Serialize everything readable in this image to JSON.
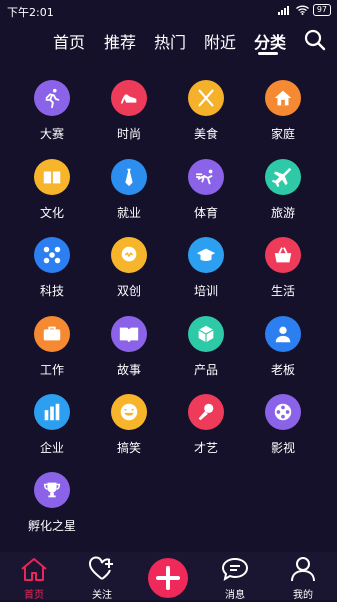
{
  "status": {
    "time": "下午2:01",
    "battery": "97"
  },
  "nav": {
    "tabs": [
      "首页",
      "推荐",
      "热门",
      "附近",
      "分类"
    ],
    "active": "分类"
  },
  "categories": [
    {
      "label": "大赛",
      "icon": "running-icon",
      "color": "#8a63e8"
    },
    {
      "label": "时尚",
      "icon": "high-heel-icon",
      "color": "#ef3b5a"
    },
    {
      "label": "美食",
      "icon": "utensils-icon",
      "color": "#f6b12a"
    },
    {
      "label": "家庭",
      "icon": "house-icon",
      "color": "#f58a32"
    },
    {
      "label": "文化",
      "icon": "book-icon",
      "color": "#f7b52c"
    },
    {
      "label": "就业",
      "icon": "tie-icon",
      "color": "#2c8ff0"
    },
    {
      "label": "体育",
      "icon": "athlete-icon",
      "color": "#8a63e8"
    },
    {
      "label": "旅游",
      "icon": "plane-icon",
      "color": "#2ec9a6"
    },
    {
      "label": "科技",
      "icon": "molecule-icon",
      "color": "#2c7ff0"
    },
    {
      "label": "双创",
      "icon": "lightbulb-icon",
      "color": "#f7b52c"
    },
    {
      "label": "培训",
      "icon": "graduation-cap-icon",
      "color": "#2c9ff0"
    },
    {
      "label": "生活",
      "icon": "basket-icon",
      "color": "#ef3b5a"
    },
    {
      "label": "工作",
      "icon": "briefcase-icon",
      "color": "#f58a32"
    },
    {
      "label": "故事",
      "icon": "open-book-icon",
      "color": "#8a63e8"
    },
    {
      "label": "产品",
      "icon": "cube-icon",
      "color": "#2ec9a6"
    },
    {
      "label": "老板",
      "icon": "boss-icon",
      "color": "#2c7ff0"
    },
    {
      "label": "企业",
      "icon": "buildings-icon",
      "color": "#2c9ff0"
    },
    {
      "label": "搞笑",
      "icon": "laugh-icon",
      "color": "#f7b52c"
    },
    {
      "label": "才艺",
      "icon": "microphone-icon",
      "color": "#ef3b5a"
    },
    {
      "label": "影视",
      "icon": "film-reel-icon",
      "color": "#8a63e8"
    },
    {
      "label": "孵化之星",
      "icon": "trophy-icon",
      "color": "#8a63e8"
    }
  ],
  "bottom_nav": [
    {
      "label": "首页",
      "icon": "home-icon",
      "active": true
    },
    {
      "label": "关注",
      "icon": "heart-plus-icon",
      "active": false
    },
    {
      "label": "",
      "icon": "plus-icon",
      "active": false
    },
    {
      "label": "消息",
      "icon": "chat-icon",
      "active": false
    },
    {
      "label": "我的",
      "icon": "user-icon",
      "active": false
    }
  ]
}
